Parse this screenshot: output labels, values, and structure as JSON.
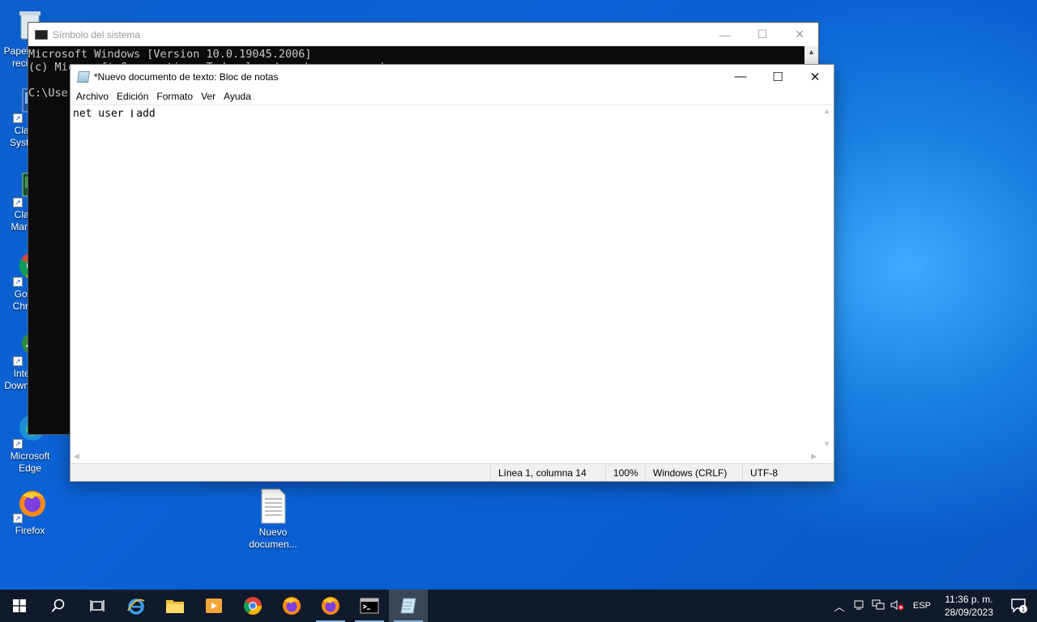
{
  "desktop": {
    "icons": [
      {
        "label": "Papelera de reciclaje"
      },
      {
        "label": "Classic System..."
      },
      {
        "label": "Classic Manager"
      },
      {
        "label": "Google Chrome"
      },
      {
        "label": "Internet Download..."
      },
      {
        "label": "Microsoft Edge"
      },
      {
        "label": "Firefox"
      },
      {
        "label": "Nuevo documen..."
      }
    ]
  },
  "cmd": {
    "title": "Símbolo del sistema",
    "lines": [
      "Microsoft Windows [Version 10.0.19045.2006]",
      "(c) Microsoft Corporation. Todos los derechos reservados.",
      "",
      "C:\\Users"
    ]
  },
  "notepad": {
    "title": "*Nuevo documento de texto: Bloc de notas",
    "menu": [
      "Archivo",
      "Edición",
      "Formato",
      "Ver",
      "Ayuda"
    ],
    "content": "net user  add",
    "status": {
      "position": "Línea 1, columna 14",
      "zoom": "100%",
      "line_endings": "Windows (CRLF)",
      "encoding": "UTF-8"
    }
  },
  "taskbar": {
    "apps": [
      "start-icon",
      "search-icon",
      "task-view-icon",
      "internet-explorer-icon",
      "file-explorer-icon",
      "media-player-icon",
      "chrome-icon",
      "firefox-icon",
      "firefox-icon",
      "cmd-icon",
      "notepad-icon"
    ],
    "language": "ESP",
    "time": "11:36 p. m.",
    "date": "28/09/2023",
    "notification_count": "1"
  }
}
